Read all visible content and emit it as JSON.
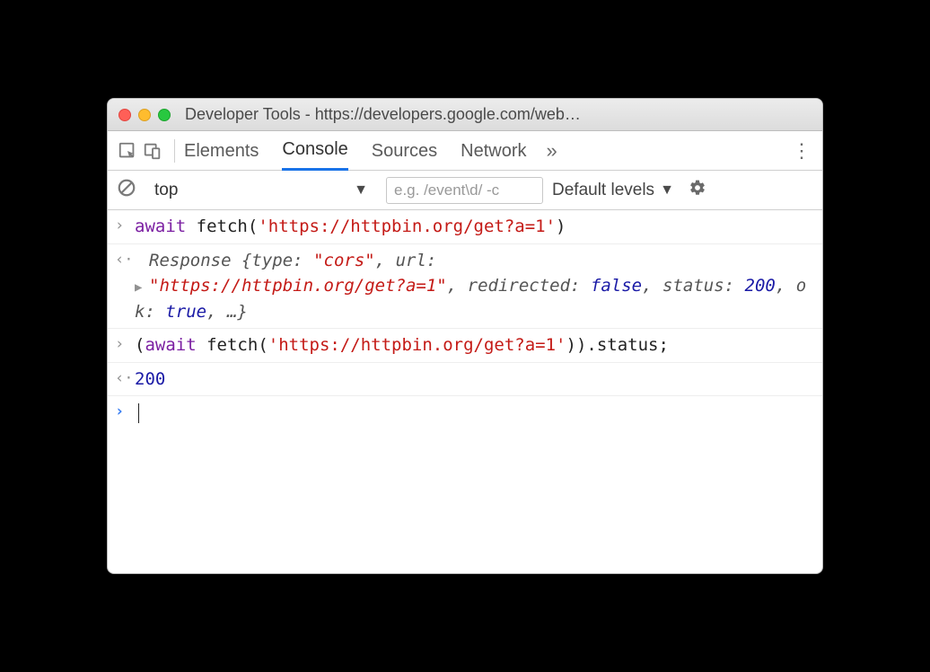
{
  "titlebar": {
    "title": "Developer Tools - https://developers.google.com/web…"
  },
  "tabs": {
    "elements": "Elements",
    "console": "Console",
    "sources": "Sources",
    "network": "Network",
    "more": "»"
  },
  "filter": {
    "context": "top",
    "placeholder": "e.g. /event\\d/ -c",
    "levels": "Default levels"
  },
  "console": {
    "line1": {
      "kw": "await",
      "fn": "fetch",
      "arg": "'https://httpbin.org/get?a=1'"
    },
    "resp": {
      "name": "Response",
      "type_key": "type:",
      "type_val": "\"cors\"",
      "url_key": "url:",
      "url_val": "\"https://httpbin.org/get?a=1\"",
      "redir_key": "redirected:",
      "redir_val": "false",
      "status_key": "status:",
      "status_val": "200",
      "ok_key": "ok:",
      "ok_val": "true",
      "tail": ", …}"
    },
    "line2": {
      "open": "(",
      "kw": "await",
      "fn": "fetch",
      "arg": "'https://httpbin.org/get?a=1'",
      "close": ")",
      "prop": ".status;"
    },
    "result2": "200"
  }
}
